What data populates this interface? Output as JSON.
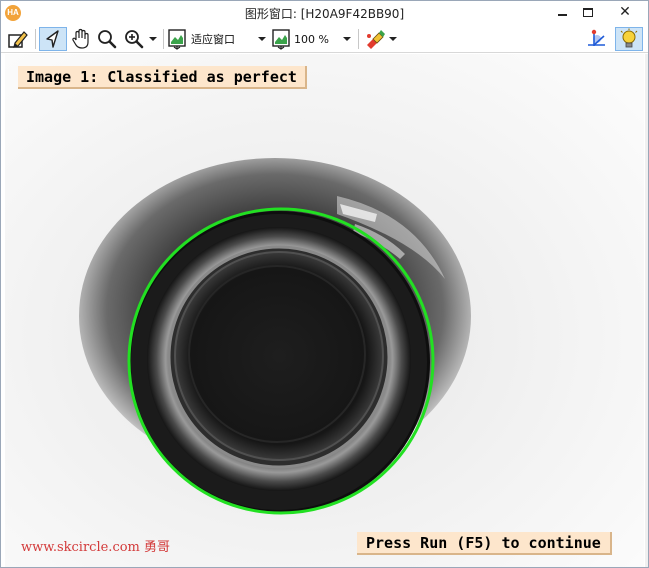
{
  "window": {
    "app_icon_text": "HA",
    "title": "图形窗口: [H20A9F42BB90]",
    "close_glyph": "✕"
  },
  "toolbar": {
    "fit_window_label": "适应窗口",
    "zoom_level": "100 %"
  },
  "icons": {
    "edit": "edit-pencil-icon",
    "pointer": "pointer-icon",
    "pan": "hand-icon",
    "magnify": "magnifier-icon",
    "zoom_in": "zoom-in-icon",
    "fit": "fit-window-icon",
    "zoom": "zoom-percent-icon",
    "paint": "paint-icon",
    "crosshair": "crosshair-icon",
    "bulb": "lightbulb-icon"
  },
  "canvas": {
    "top_label": "Image 1: Classified as perfect",
    "bottom_label": "Press Run (F5) to continue",
    "watermark": "www.skcircle.com 勇哥",
    "circle_color": "#22e022",
    "label_bg": "#fde6cc"
  }
}
